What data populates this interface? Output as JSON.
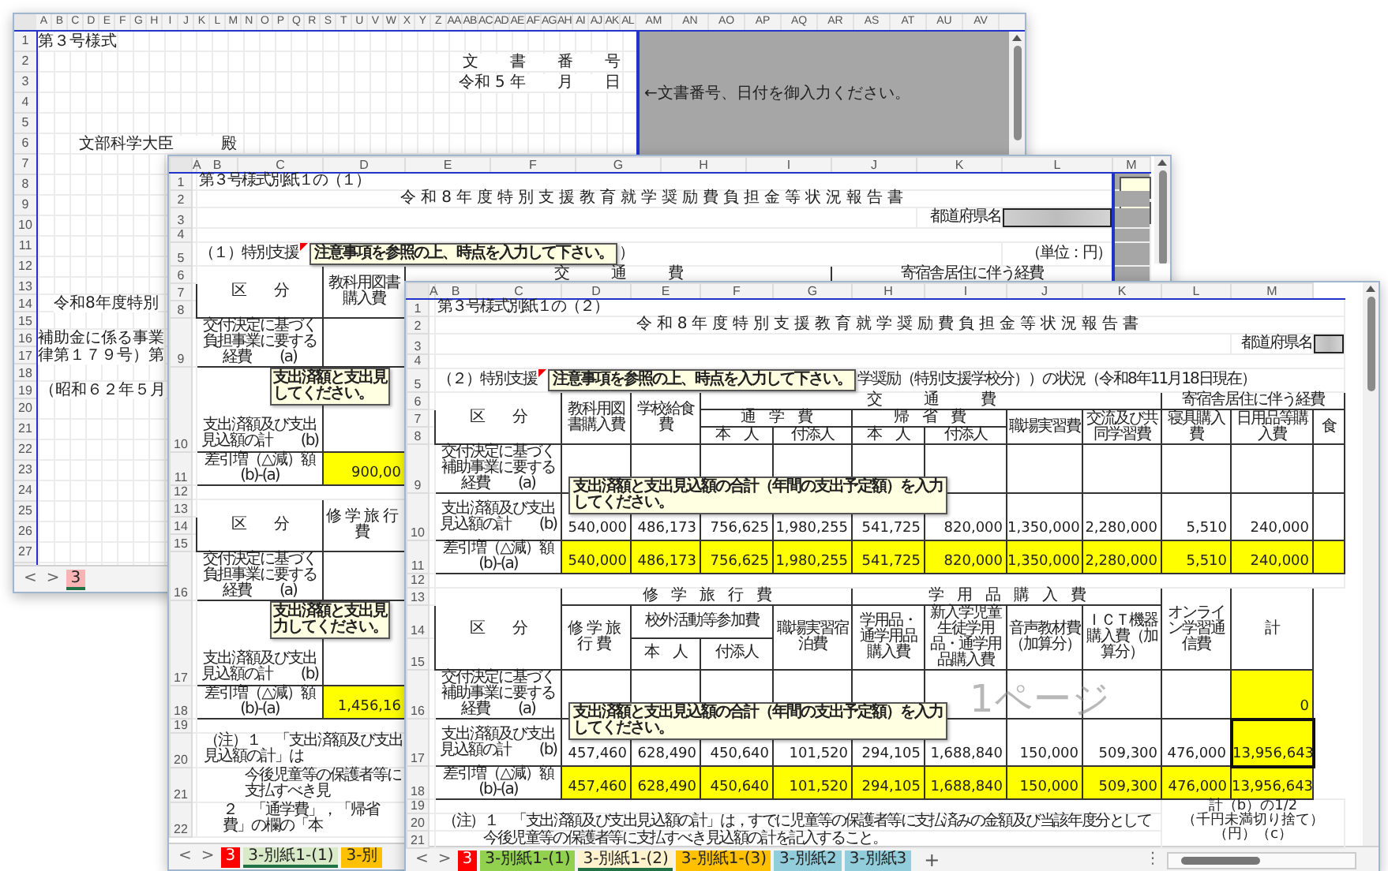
{
  "window_1": {
    "columns": [
      "A",
      "B",
      "C",
      "D",
      "E",
      "F",
      "G",
      "H",
      "I",
      "J",
      "K",
      "L",
      "M",
      "N",
      "O",
      "P",
      "Q",
      "R",
      "S",
      "T",
      "U",
      "V",
      "W",
      "X",
      "Y",
      "Z",
      "AA",
      "AB",
      "AC",
      "AD",
      "AE",
      "AF",
      "AG",
      "AH",
      "AI",
      "AJ",
      "AK",
      "AL",
      "AM",
      "AN",
      "AO",
      "AP",
      "AQ",
      "AR",
      "AS",
      "AT",
      "AU",
      "AV"
    ],
    "rows": [
      "1",
      "2",
      "3",
      "4",
      "5",
      "6",
      "7",
      "8",
      "9",
      "10",
      "11",
      "12",
      "13",
      "14",
      "15",
      "16",
      "17",
      "18",
      "19",
      "20",
      "21",
      "22",
      "23",
      "24",
      "25",
      "26",
      "27"
    ],
    "form_label": "第３号様式",
    "document_number_label": "文　　書　　番　　号",
    "date_label": "令和 5 年　　月　　日",
    "date_note": "←文書番号、日付を御入力ください。",
    "addressee": "文部科学大臣　　　殿",
    "body_lines": [
      "令和8年度特別",
      "補助金に係る事業",
      "律第１７９号）第",
      "（昭和６２年５月"
    ],
    "sheet_nav": [
      "<",
      ">"
    ],
    "sheet_tabs": [
      {
        "label": "3",
        "color": "#f8b4b4",
        "selected": true
      }
    ]
  },
  "window_2": {
    "columns": [
      "A",
      "B",
      "C",
      "D",
      "E",
      "F",
      "G",
      "H",
      "I",
      "J",
      "K",
      "L",
      "M"
    ],
    "rows": [
      "1",
      "2",
      "3",
      "4",
      "5",
      "6",
      "7",
      "8",
      "9",
      "10",
      "11",
      "12",
      "13",
      "14",
      "15",
      "16",
      "17",
      "18",
      "19",
      "20",
      "21",
      "22"
    ],
    "form_label": "第３号様式別紙１の（１）",
    "title": "令和8年度特別支援教育就学奨励費負担金等状況報告書",
    "prefecture_label": "都道府県名",
    "unit_label": "（単位：円）",
    "section_label": "（１）特別支援",
    "date_tooltip": "注意事項を参照の上、**時点を入力して下さい。**",
    "section_label_tail": "）",
    "table_1": {
      "category_header": "区　　分",
      "textbook_header": "教科用図書購入費",
      "transport_header": "交　　　通　　　費",
      "dormitory_header": "寄宿舎居住に伴う経費",
      "rows": [
        {
          "label": "交付決定に基づく負担事業に要する経費　　(a)",
          "highlighted": false
        },
        {
          "label": "支出済額及び支出見込額の計　　(b)",
          "highlighted": false
        },
        {
          "label": "差引増（△減）額　　(b)-(a)",
          "highlighted": true,
          "value": "900,00"
        }
      ]
    },
    "tooltip_1": [
      "支出済額と支出見",
      "してください。"
    ],
    "table_2": {
      "category_header": "区　　分",
      "trip_header": "修学旅行費",
      "rows": [
        {
          "label": "交付決定に基づく負担事業に要する経費　　(a)",
          "highlighted": false
        },
        {
          "label": "支出済額及び支出見込額の計　　(b)",
          "highlighted": false
        },
        {
          "label": "差引増（△減）額　　(b)-(a)",
          "highlighted": true,
          "value": "1,456,16"
        }
      ]
    },
    "tooltip_2": [
      "支出済額と支出見",
      "力してください。"
    ],
    "notes": [
      "（注）１　「支出済額及び支出見込額の計」は",
      "今後児童等の保護者等に支払すべき見",
      "２　「通学費」，「帰省費」の欄の「本"
    ],
    "sheet_nav": [
      "<",
      ">"
    ],
    "sheet_tabs": [
      {
        "label": "3",
        "color": "#ff0000",
        "selected": false
      },
      {
        "label": "3-別紙1-(1)",
        "color": "#d8eac8",
        "selected": true
      },
      {
        "label": "3-別",
        "color": "#ffc000",
        "selected": false
      }
    ]
  },
  "window_3": {
    "columns": [
      "A",
      "B",
      "C",
      "D",
      "E",
      "F",
      "G",
      "H",
      "I",
      "J",
      "K",
      "L",
      "M"
    ],
    "rows": [
      "1",
      "2",
      "3",
      "4",
      "5",
      "6",
      "7",
      "8",
      "9",
      "10",
      "11",
      "12",
      "13",
      "14",
      "15",
      "16",
      "17",
      "18",
      "19",
      "20",
      "21"
    ],
    "form_label": "第３号様式別紙１の（２）",
    "title": "令和8年度特別支援教育就学奨励費負担金等状況報告書",
    "prefecture_label": "都道府県名",
    "section_label": "（２）特別支援",
    "date_tooltip": "注意事項を参照の上、時点を入力して下さい。",
    "section_label_tail": "学奨励（特別支援学校分））の状況（令和8年11月18日現在）",
    "table_1": {
      "category_header": "区　　分",
      "textbook_header": "教科用図書購入費",
      "lunch_header": "学校給食費",
      "transport_header": "交　　　通　　　費",
      "dormitory_header": "寄宿舎居住に伴う経費",
      "commute_header": "通　学　費",
      "home_visit_header": "帰　省　費",
      "internship_header": "職場実習費",
      "exchange_header": "交流及び共同学習費",
      "bedding_header": "寝具購入費",
      "daily_goods_header": "日用品等購入費",
      "meal_header": "食",
      "person_headers": [
        "本　人",
        "付添人",
        "本　人",
        "付添人"
      ],
      "rows": [
        {
          "label": "交付決定に基づく補助事業に要する経費　　(a)",
          "highlighted": false
        },
        {
          "label": "支出済額及び支出見込額の計　　(b)",
          "highlighted": false,
          "values": [
            "540,000",
            "486,173",
            "756,625",
            "1,980,255",
            "541,725",
            "820,000",
            "1,350,000",
            "2,280,000",
            "5,510",
            "240,000"
          ]
        },
        {
          "label": "差引増（△減）額　　(b)-(a)",
          "highlighted": true,
          "values": [
            "540,000",
            "486,173",
            "756,625",
            "1,980,255",
            "541,725",
            "820,000",
            "1,350,000",
            "2,280,000",
            "5,510",
            "240,000"
          ]
        }
      ]
    },
    "tooltip_1": [
      "支出済額と支出見込額の合計（年間の支出予定額）を入力",
      "してください。"
    ],
    "table_2": {
      "category_header": "区　　分",
      "trip_group_header": "修　学　旅　行　費",
      "goods_group_header": "学　用　品　購　入　費",
      "online_header": "オンライン学習通信費",
      "total_header": "計",
      "trip_header": "修学旅行費",
      "outing_header": "校外活動等参加費",
      "internship_stay_header": "職場実習宿泊費",
      "goods_header": "学用品・通学用品購入費",
      "new_student_header": "新入学児童生徒学用品・通学用品購入費",
      "audio_header": "音声教材費（加算分）",
      "ict_header": "ＩＣＴ機器購入費（加算分）",
      "person_headers": [
        "本　人",
        "付添人"
      ],
      "rows": [
        {
          "label": "交付決定に基づく補助事業に要する経費　　(a)",
          "highlighted": false,
          "total": {
            "text": "0",
            "highlighted": true,
            "selected": false
          }
        },
        {
          "label": "支出済額及び支出見込額の計　　(b)",
          "highlighted": false,
          "values": [
            "457,460",
            "628,490",
            "450,640",
            "101,520",
            "294,105",
            "1,688,840",
            "150,000",
            "509,300",
            "476,000"
          ],
          "total": {
            "text": "13,956,643",
            "highlighted": true,
            "selected": true
          }
        },
        {
          "label": "差引増（△減）額　　(b)-(a)",
          "highlighted": true,
          "values": [
            "457,460",
            "628,490",
            "450,640",
            "101,520",
            "294,105",
            "1,688,840",
            "150,000",
            "509,300",
            "476,000"
          ],
          "total": {
            "text": "13,956,643",
            "highlighted": true,
            "selected": false
          }
        }
      ]
    },
    "tooltip_2": [
      "支出済額と支出見込額の合計（年間の支出予定額）を入力",
      "してください。"
    ],
    "notes": [
      "（注）１　「支出済額及び支出見込額の計」は，すでに児童等の保護者等に支払済みの金額及び当該年度分として",
      "今後児童等の保護者等に支払すべき見込額の計を記入すること。"
    ],
    "total_note": [
      "計（b）の1/2",
      "（千円未満切り捨て）",
      "（円）（c）"
    ],
    "page_watermark": "1ページ",
    "sheet_nav": [
      "<",
      ">"
    ],
    "sheet_tabs": [
      {
        "label": "3",
        "color": "#ff0000",
        "selected": false
      },
      {
        "label": "3-別紙1-(1)",
        "color": "#92d050",
        "selected": false
      },
      {
        "label": "3-別紙1-(2)",
        "color": "#fff2cc",
        "selected": true
      },
      {
        "label": "3-別紙1-(3)",
        "color": "#ffc000",
        "selected": false
      },
      {
        "label": "3-別紙2",
        "color": "#92cddc",
        "selected": false
      },
      {
        "label": "3-別紙3",
        "color": "#92cddc",
        "selected": false
      }
    ],
    "add_sheet": "+",
    "more_menu": "⋮"
  }
}
